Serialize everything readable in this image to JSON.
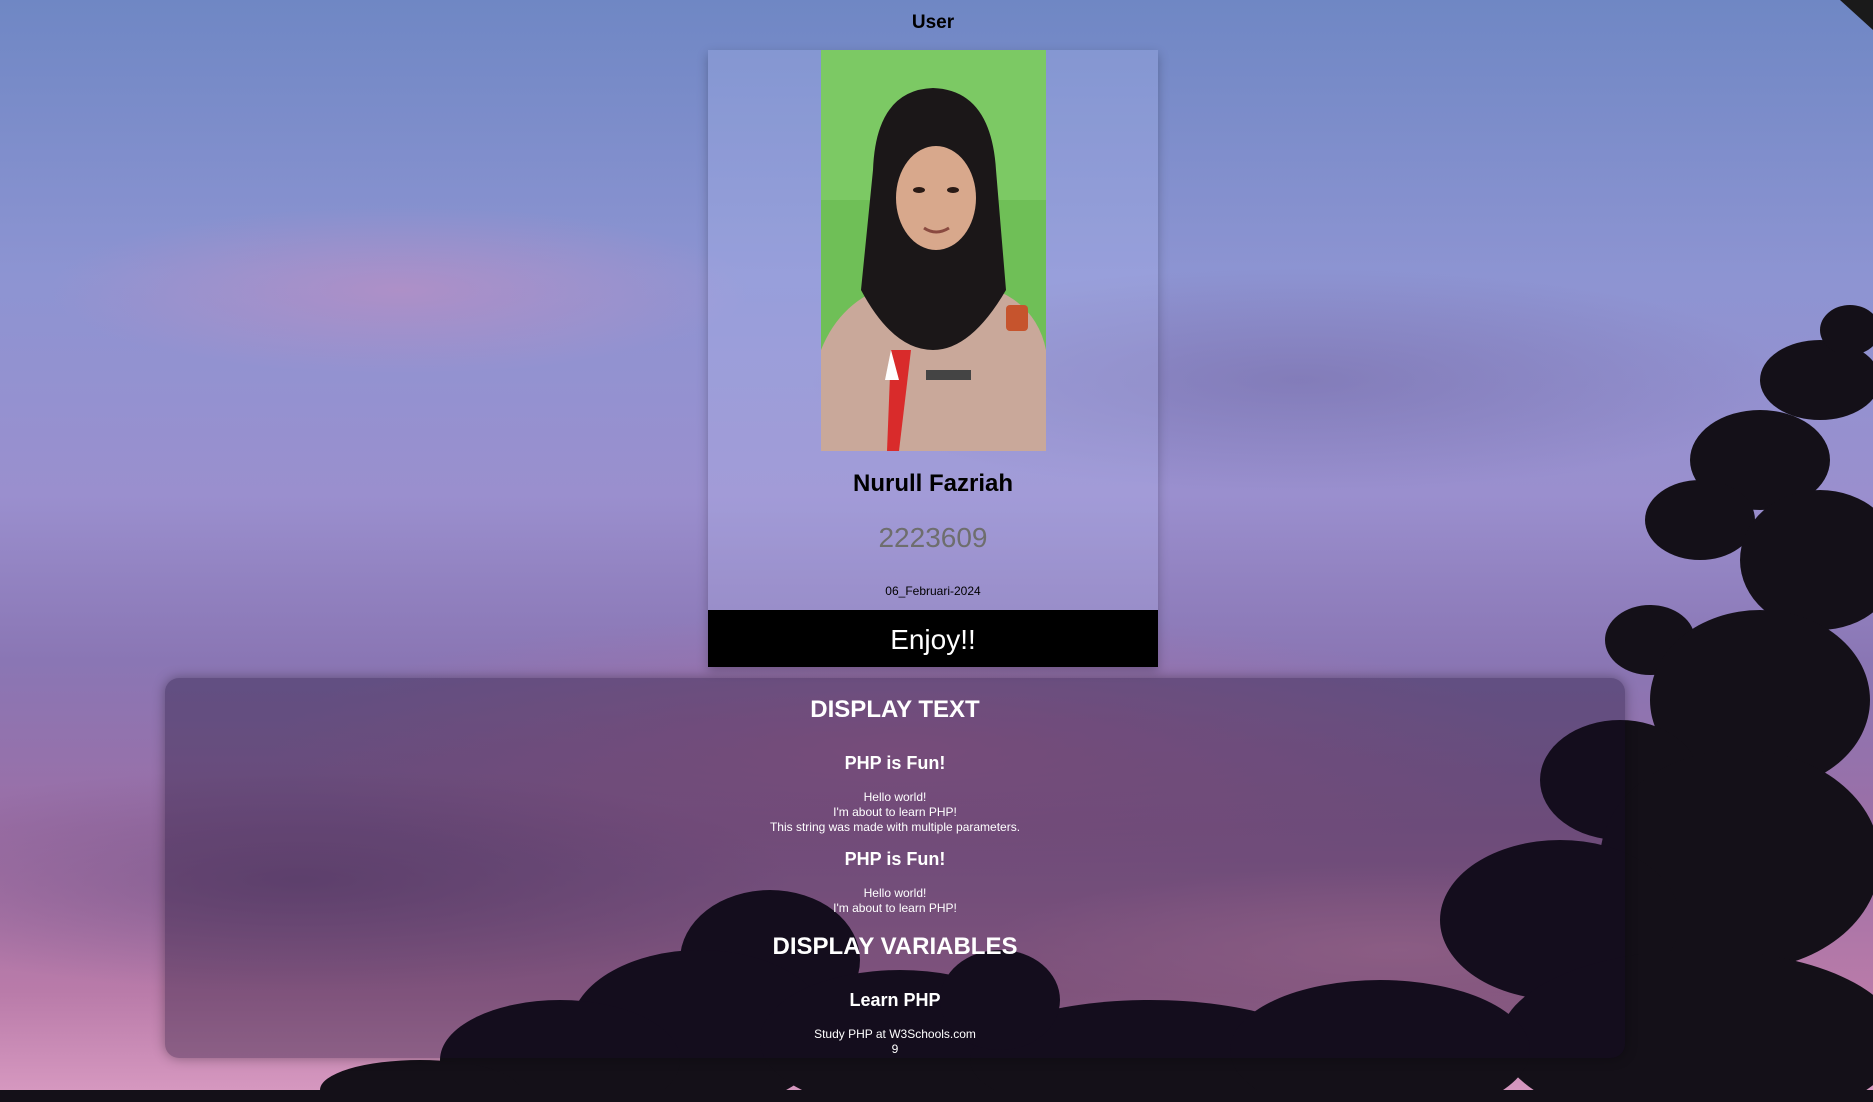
{
  "header": {
    "title": "User"
  },
  "profile": {
    "photo_alt": "profile photo",
    "name": "Nurull Fazriah",
    "id_number": "2223609",
    "date": "06_Februari-2024",
    "button_label": "Enjoy!!"
  },
  "display_text": {
    "heading": "DISPLAY TEXT",
    "block1": {
      "title": "PHP is Fun!",
      "lines": [
        "Hello world!",
        "I'm about to learn PHP!",
        "This string was made with multiple parameters."
      ]
    },
    "block2": {
      "title": "PHP is Fun!",
      "lines": [
        "Hello world!",
        "I'm about to learn PHP!"
      ]
    }
  },
  "display_variables": {
    "heading": "DISPLAY VARIABLES",
    "title": "Learn PHP",
    "lines": [
      "Study PHP at W3Schools.com",
      "9"
    ]
  },
  "colors": {
    "card_button_bg": "#000000",
    "id_text": "#6e6e6e"
  }
}
